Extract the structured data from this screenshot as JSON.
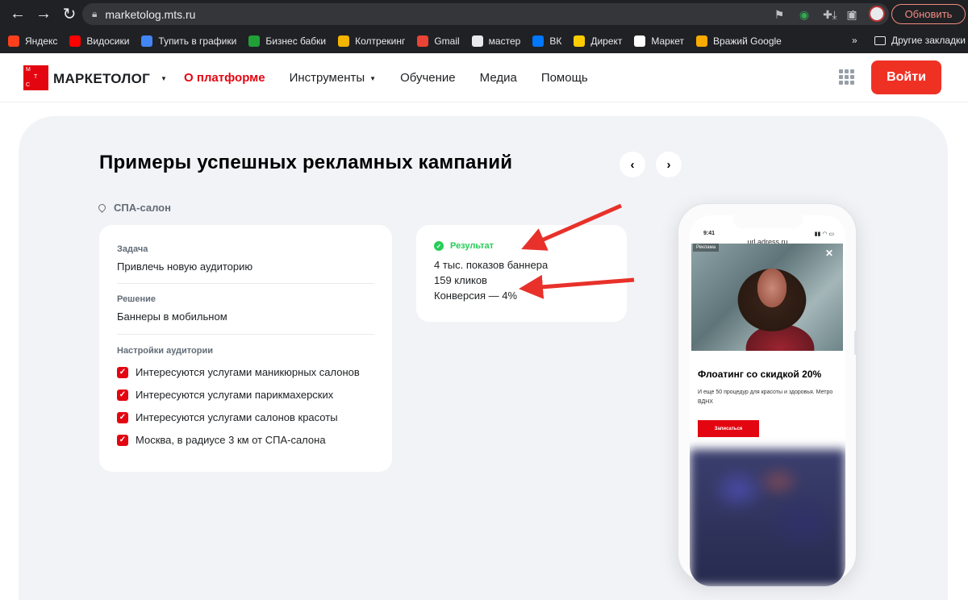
{
  "browser": {
    "url": "marketolog.mts.ru",
    "update_label": "Обновить",
    "bookmarks": [
      {
        "label": "Яндекс",
        "icon": "yandex-icon",
        "color": "#fc3f1d"
      },
      {
        "label": "Видосики",
        "icon": "youtube-icon",
        "color": "#ff0000"
      },
      {
        "label": "Тупить в графики",
        "icon": "chrome-icon",
        "color": "#4285f4"
      },
      {
        "label": "Бизнес бабки",
        "icon": "sber-icon",
        "color": "#21a038"
      },
      {
        "label": "Колтрекинг",
        "icon": "bars-icon",
        "color": "#f4b400"
      },
      {
        "label": "Gmail",
        "icon": "gmail-icon",
        "color": "#ea4335"
      },
      {
        "label": "мастер",
        "icon": "code-icon",
        "color": "#e8eaed"
      },
      {
        "label": "ВК",
        "icon": "vk-icon",
        "color": "#0077ff"
      },
      {
        "label": "Директ",
        "icon": "direct-icon",
        "color": "#ffcc00"
      },
      {
        "label": "Маркет",
        "icon": "market-icon",
        "color": "#ffffff"
      },
      {
        "label": "Вражий Google",
        "icon": "analytics-icon",
        "color": "#f9ab00"
      }
    ],
    "more_bookmarks": "»",
    "other_bookmarks": "Другие закладки"
  },
  "header": {
    "logo_letters": [
      "М",
      "Т",
      "С"
    ],
    "brand": "МАРКЕТОЛОГ",
    "nav": [
      {
        "label": "О платформе",
        "active": true
      },
      {
        "label": "Инструменты",
        "dropdown": true
      },
      {
        "label": "Обучение"
      },
      {
        "label": "Медиа"
      },
      {
        "label": "Помощь"
      }
    ],
    "login_label": "Войти",
    "accent_color": "#e30611"
  },
  "section": {
    "title": "Примеры успешных рекламных кампаний",
    "prev_label": "‹",
    "next_label": "›",
    "location": "СПА-салон"
  },
  "task_card": {
    "task_label": "Задача",
    "task_value": "Привлечь новую аудиторию",
    "solution_label": "Решение",
    "solution_value": "Баннеры в мобильном",
    "audience_label": "Настройки аудитории",
    "audience_items": [
      "Интересуются услугами маникюрных салонов",
      "Интересуются услугами парикмахерских",
      "Интересуются услугами салонов красоты",
      "Москва, в радиусе 3 км от СПА-салона"
    ]
  },
  "result_card": {
    "title": "Результат",
    "lines": [
      "4 тыс. показов баннера",
      "159 кликов",
      "Конверсия — 4%"
    ],
    "color": "#26cd58"
  },
  "phone": {
    "time": "9:41",
    "url": "url.adress.ru",
    "ad_badge": "Реклама",
    "ad_title": "Флоатинг со скидкой 20%",
    "ad_text": "И еще 50 процедур для красоты и здоровья. Метро ВДНХ",
    "ad_button": "Записаться"
  }
}
